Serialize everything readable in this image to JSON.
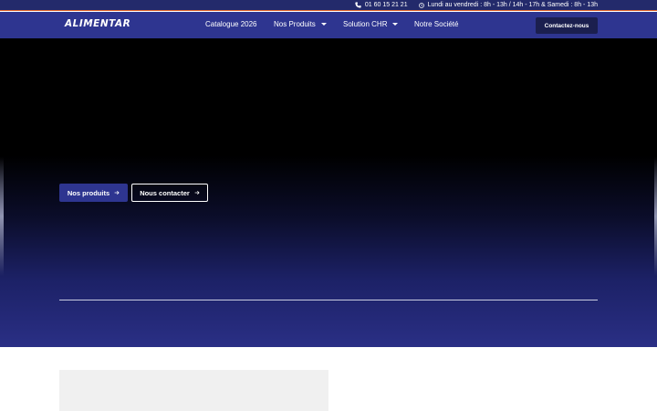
{
  "topbar": {
    "phone": "01 60 15 21 21",
    "phone_icon": "phone-icon",
    "hours": "Lundi au vendredi : 8h - 13h / 14h - 17h & Samedi : 8h - 13h",
    "hours_icon": "clock-icon"
  },
  "nav": {
    "logo": "ALIMENTAR",
    "items": [
      {
        "label": "Catalogue 2026",
        "dropdown": false
      },
      {
        "label": "Nos Produits",
        "dropdown": true
      },
      {
        "label": "Solution CHR",
        "dropdown": true
      },
      {
        "label": "Notre Société",
        "dropdown": false
      }
    ],
    "cta": "Contactez-nous"
  },
  "hero": {
    "primary_button": "Nos produits",
    "secondary_button": "Nous contacter",
    "button_icon": "arrow-right-icon"
  },
  "colors": {
    "topbar_bg": "#232a6b",
    "nav_bg": "#2e3590",
    "accent_line": "#e0642a",
    "cta_bg": "#1b1f4f",
    "hero_bottom": "#2a2f85"
  }
}
